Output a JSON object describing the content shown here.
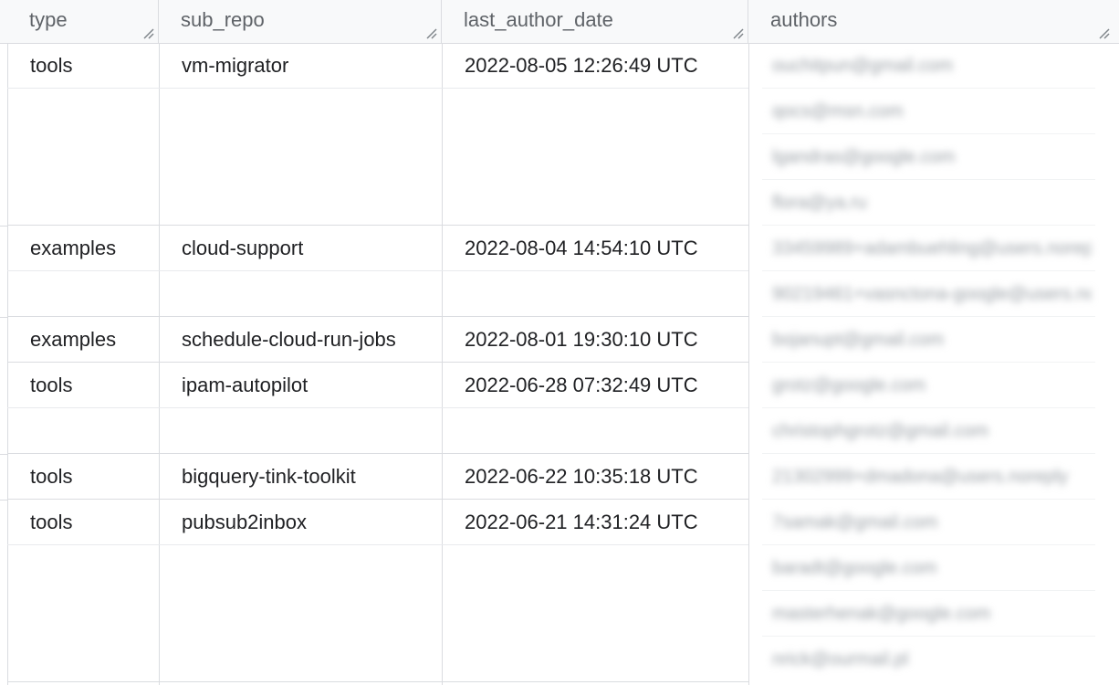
{
  "columns": [
    "type",
    "sub_repo",
    "last_author_date",
    "authors"
  ],
  "rows": [
    {
      "type": "tools",
      "sub_repo": "vm-migrator",
      "last_author_date": "2022-08-05 12:26:49 UTC"
    },
    {
      "type": "examples",
      "sub_repo": "cloud-support",
      "last_author_date": "2022-08-04 14:54:10 UTC"
    },
    {
      "type": "examples",
      "sub_repo": "schedule-cloud-run-jobs",
      "last_author_date": "2022-08-01 19:30:10 UTC"
    },
    {
      "type": "tools",
      "sub_repo": "ipam-autopilot",
      "last_author_date": "2022-06-28 07:32:49 UTC"
    },
    {
      "type": "tools",
      "sub_repo": "bigquery-tink-toolkit",
      "last_author_date": "2022-06-22 10:35:18 UTC"
    },
    {
      "type": "tools",
      "sub_repo": "pubsub2inbox",
      "last_author_date": "2022-06-21 14:31:24 UTC"
    }
  ],
  "authors": [
    "ouchitpun@gmail.com",
    "qocs@msn.com",
    "lgandras@google.com",
    "flora@ya.ru",
    "33459989+adambuehling@users.noreply",
    "90219461+vasnctona-google@users.noreply",
    "bojanupt@gmail.com",
    "grotz@google.com",
    "christophgrotz@gmail.com",
    "21302999+dmadona@users.noreply",
    "7samak@gmail.com",
    "baradt@google.com",
    "masterhenak@google.com",
    "nrick@ourmail.pl"
  ]
}
